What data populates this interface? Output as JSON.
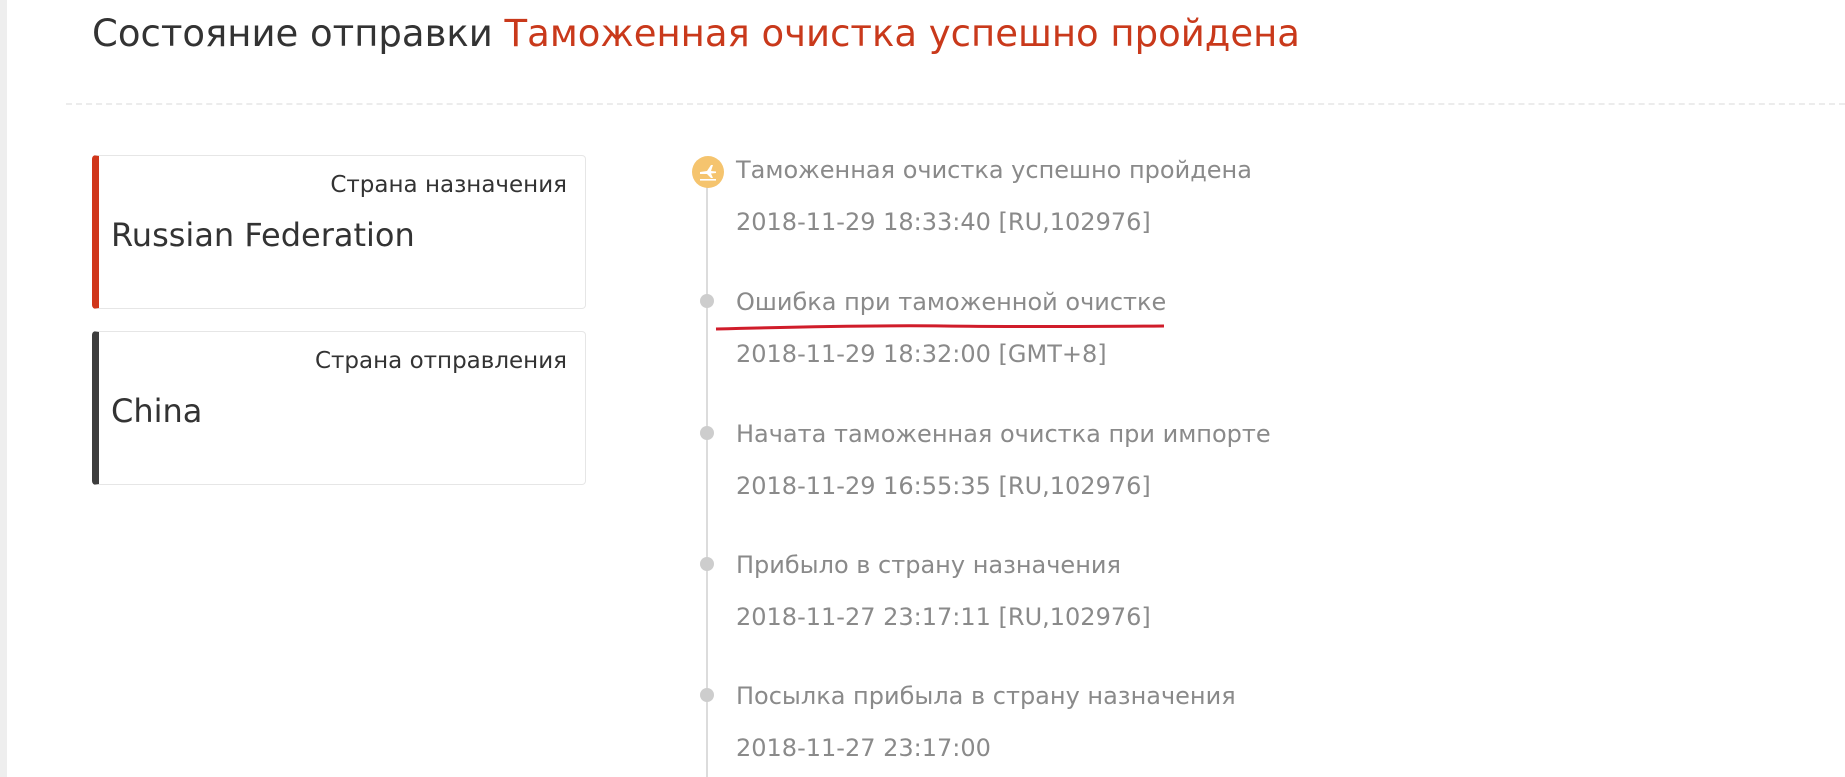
{
  "header": {
    "label": "Состояние отправки",
    "status": "Таможенная очистка успешно пройдена"
  },
  "cards": {
    "destination": {
      "caption": "Страна назначения",
      "country": "Russian Federation"
    },
    "origin": {
      "caption": "Страна отправления",
      "country": "China"
    }
  },
  "timeline": [
    {
      "title": "Таможенная очистка успешно пройдена",
      "time": "2018-11-29 18:33:40 [RU,102976]",
      "icon": "plane-landing-icon"
    },
    {
      "title": "Ошибка при таможенной очистке",
      "time": "2018-11-29 18:32:00 [GMT+8]",
      "highlighted": true
    },
    {
      "title": "Начата таможенная очистка при импорте",
      "time": "2018-11-29 16:55:35 [RU,102976]"
    },
    {
      "title": "Прибыло в страну назначения",
      "time": "2018-11-27 23:17:11 [RU,102976]"
    },
    {
      "title": "Посылка прибыла в страну назначения",
      "time": "2018-11-27 23:17:00"
    }
  ],
  "colors": {
    "accent": "#c9391b",
    "destination_bar": "#d0361b",
    "origin_bar": "#3d3d3d",
    "latest_marker": "#f5c46e",
    "dot": "#cdcdcd",
    "annotation": "#d01c2a"
  }
}
